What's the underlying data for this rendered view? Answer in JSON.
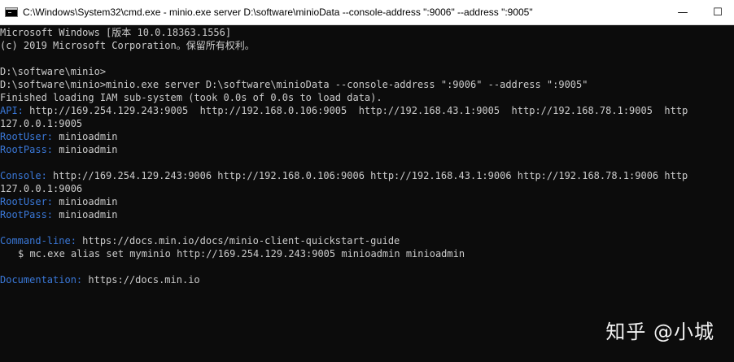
{
  "window": {
    "title": "C:\\Windows\\System32\\cmd.exe - minio.exe  server D:\\software\\minioData --console-address \":9006\" --address \":9005\"",
    "minimize_glyph": "—",
    "maximize_glyph": "☐"
  },
  "terminal": {
    "banner_1": "Microsoft Windows [版本 10.0.18363.1556]",
    "banner_2": "(c) 2019 Microsoft Corporation。保留所有权利。",
    "prompt_1": "D:\\software\\minio>",
    "command": "D:\\software\\minio>minio.exe server D:\\software\\minioData --console-address \":9006\" --address \":9005\"",
    "iam_status": "Finished loading IAM sub-system (took 0.0s of 0.0s to load data).",
    "api": {
      "label": "API:",
      "urls": " http://169.254.129.243:9005  http://192.168.0.106:9005  http://192.168.43.1:9005  http://192.168.78.1:9005  http",
      "continuation": "127.0.0.1:9005",
      "root_user_label": "RootUser:",
      "root_user": " minioadmin",
      "root_pass_label": "RootPass:",
      "root_pass": " minioadmin"
    },
    "console": {
      "label": "Console:",
      "urls": " http://169.254.129.243:9006 http://192.168.0.106:9006 http://192.168.43.1:9006 http://192.168.78.1:9006 http",
      "continuation": "127.0.0.1:9006",
      "root_user_label": "RootUser:",
      "root_user": " minioadmin",
      "root_pass_label": "RootPass:",
      "root_pass": " minioadmin"
    },
    "command_line": {
      "label": "Command-line:",
      "url": " https://docs.min.io/docs/minio-client-quickstart-guide",
      "example": "$ mc.exe alias set myminio http://169.254.129.243:9005 minioadmin minioadmin"
    },
    "documentation": {
      "label": "Documentation:",
      "url": " https://docs.min.io"
    }
  },
  "watermark": "知乎 @小城",
  "colors": {
    "background": "#0c0c0c",
    "text": "#cccccc",
    "label": "#3a78d8",
    "titlebar": "#ffffff"
  },
  "icons": {
    "app_icon": "cmd-icon",
    "minimize": "minimize-icon",
    "maximize": "maximize-icon"
  }
}
